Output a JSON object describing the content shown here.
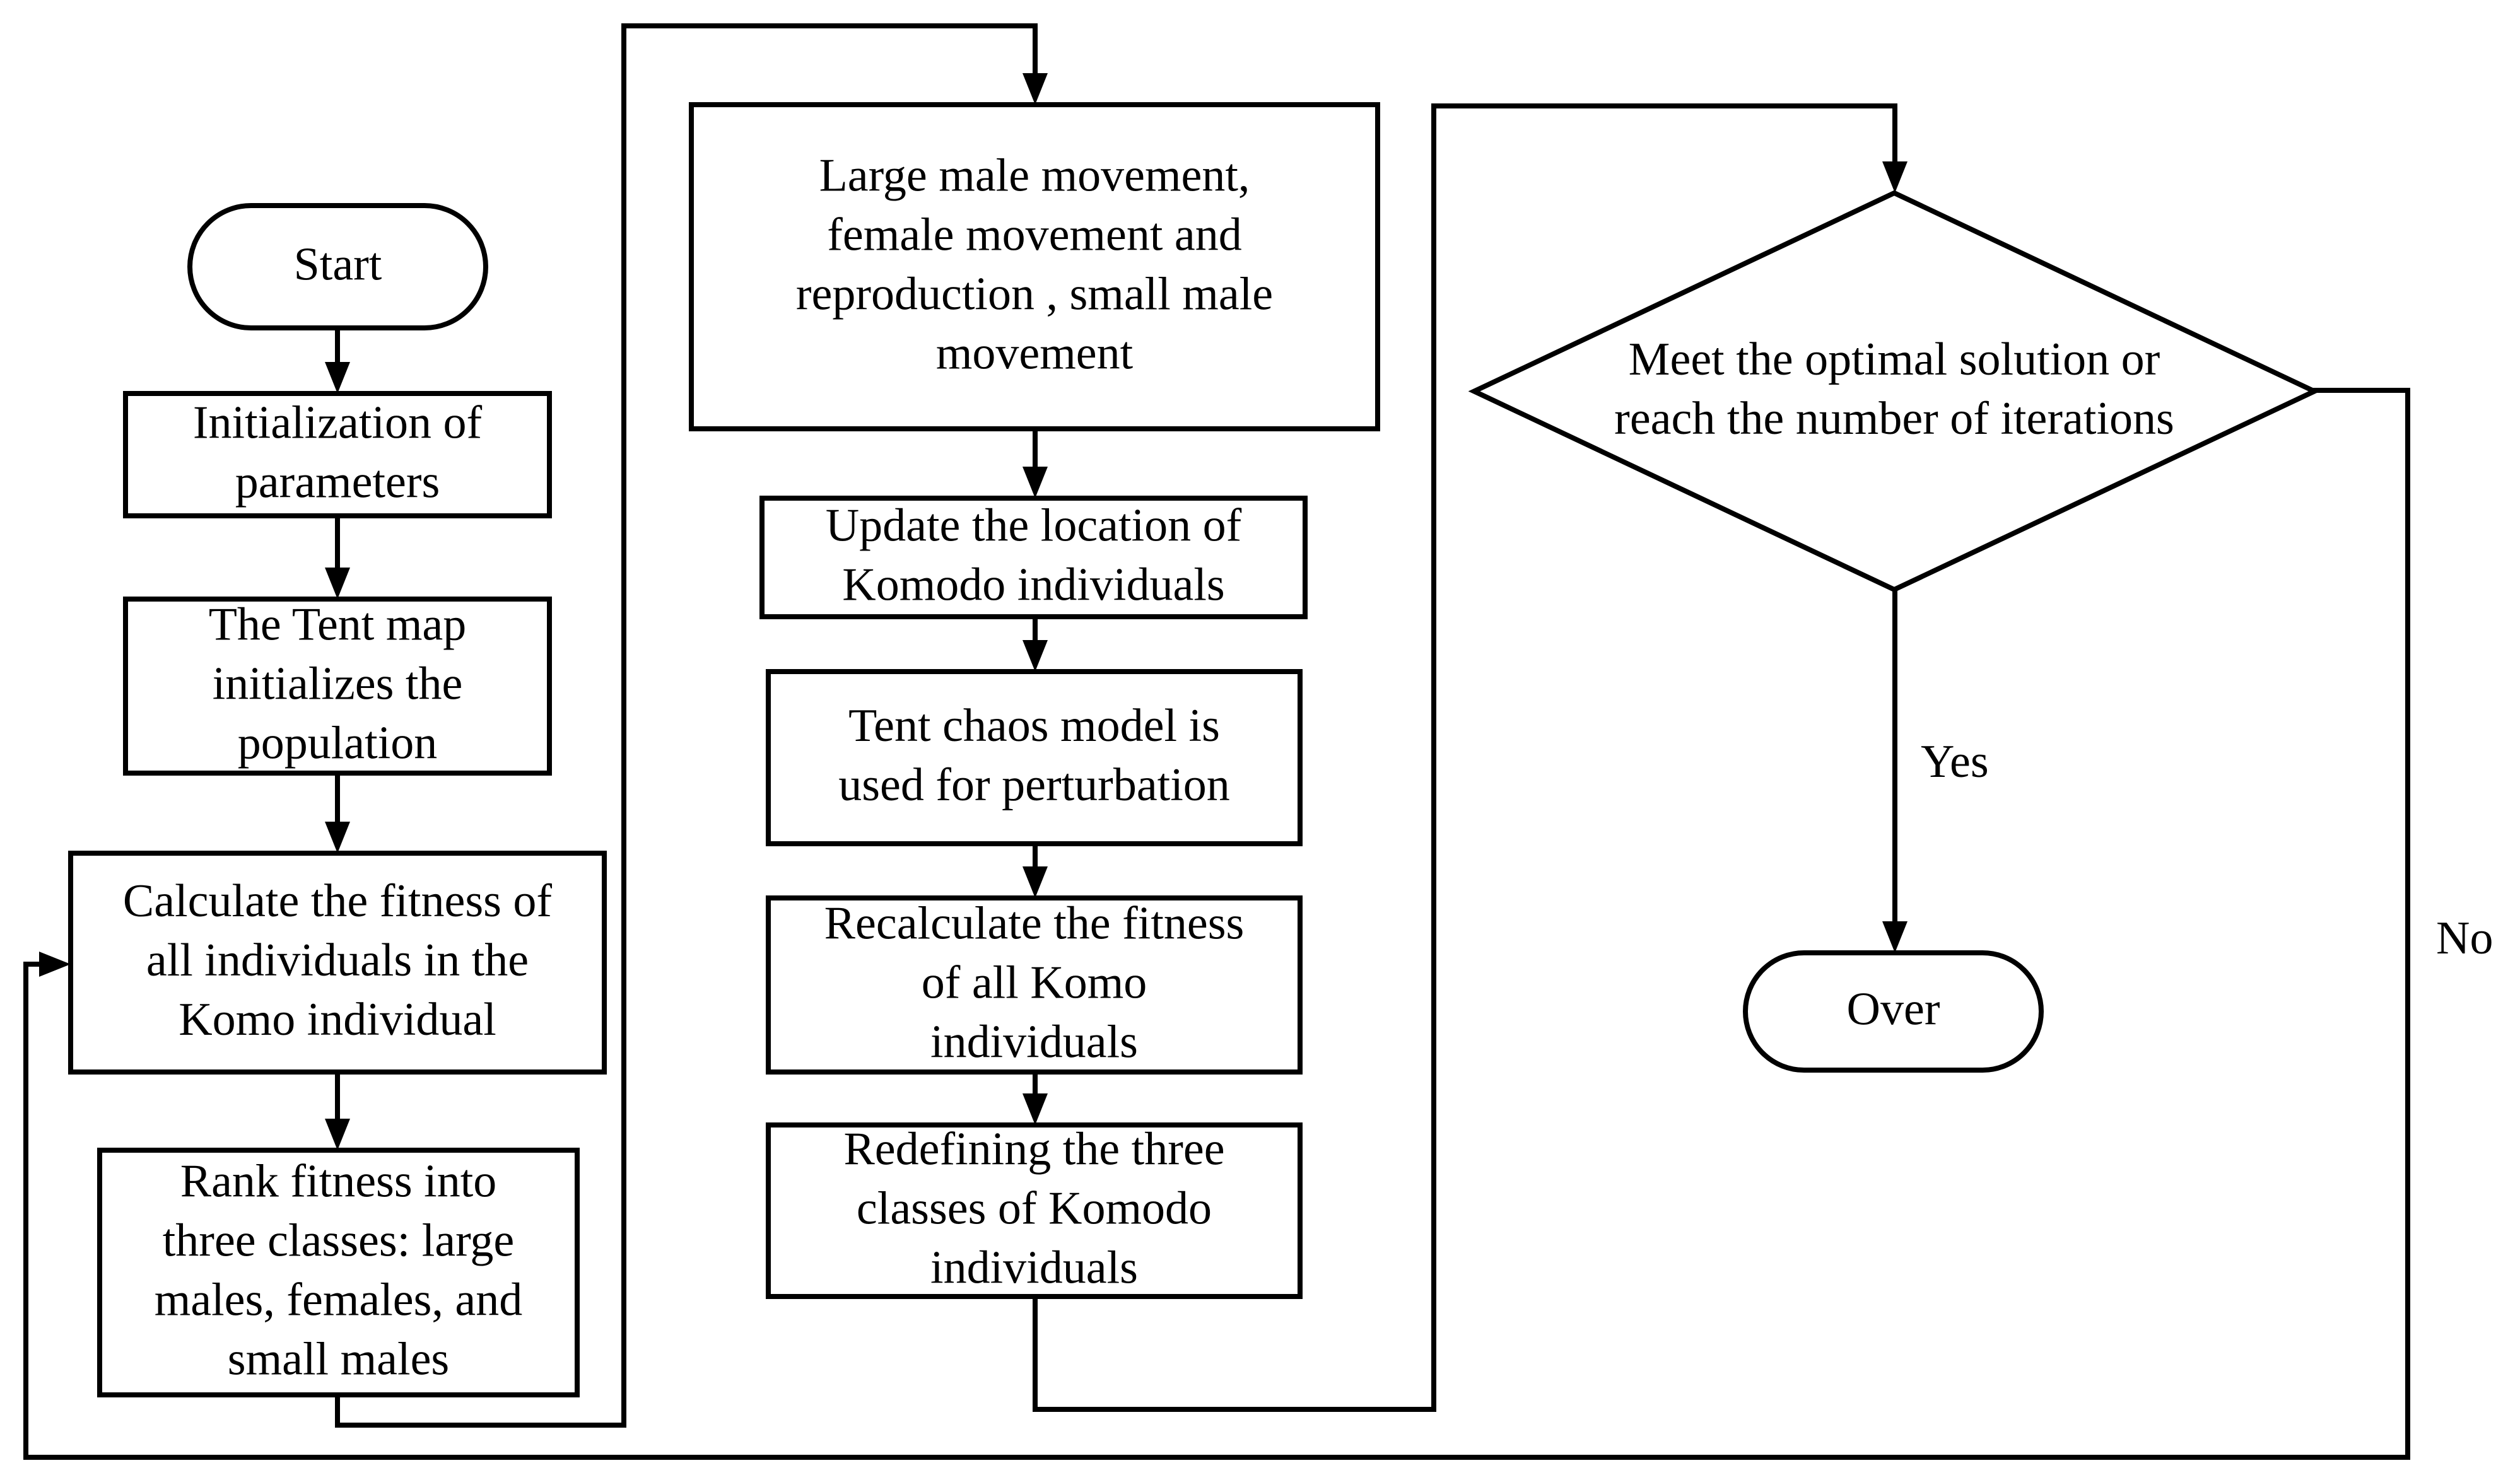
{
  "diagram": {
    "type": "flowchart",
    "nodes": {
      "start": {
        "shape": "terminator",
        "lines": [
          "Start"
        ]
      },
      "init_params": {
        "shape": "process",
        "lines": [
          "Initialization of",
          "parameters"
        ]
      },
      "tent_init": {
        "shape": "process",
        "lines": [
          "The Tent map",
          "initializes the",
          "population"
        ]
      },
      "calc_fitness": {
        "shape": "process",
        "lines": [
          "Calculate the fitness of",
          "all individuals in the",
          "Komo individual"
        ]
      },
      "rank_fitness": {
        "shape": "process",
        "lines": [
          "Rank fitness into",
          "three classes: large",
          "males, females, and",
          "small males"
        ]
      },
      "movement": {
        "shape": "process",
        "lines": [
          "Large male movement,",
          "female movement and",
          "reproduction , small male",
          "movement"
        ]
      },
      "update_location": {
        "shape": "process",
        "lines": [
          "Update the location of",
          "Komodo individuals"
        ]
      },
      "tent_chaos": {
        "shape": "process",
        "lines": [
          "Tent chaos model is",
          "used for perturbation"
        ]
      },
      "recalc_fitness": {
        "shape": "process",
        "lines": [
          "Recalculate the fitness",
          "of all Komo",
          "individuals"
        ]
      },
      "redefine_classes": {
        "shape": "process",
        "lines": [
          "Redefining the three",
          "classes of Komodo",
          "individuals"
        ]
      },
      "decision": {
        "shape": "decision",
        "lines": [
          "Meet the optimal solution or",
          "reach the number of iterations"
        ]
      },
      "over": {
        "shape": "terminator",
        "lines": [
          "Over"
        ]
      }
    },
    "edges": [
      {
        "from": "start",
        "to": "init_params",
        "label": ""
      },
      {
        "from": "init_params",
        "to": "tent_init",
        "label": ""
      },
      {
        "from": "tent_init",
        "to": "calc_fitness",
        "label": ""
      },
      {
        "from": "calc_fitness",
        "to": "rank_fitness",
        "label": ""
      },
      {
        "from": "rank_fitness",
        "to": "movement",
        "label": ""
      },
      {
        "from": "movement",
        "to": "update_location",
        "label": ""
      },
      {
        "from": "update_location",
        "to": "tent_chaos",
        "label": ""
      },
      {
        "from": "tent_chaos",
        "to": "recalc_fitness",
        "label": ""
      },
      {
        "from": "recalc_fitness",
        "to": "redefine_classes",
        "label": ""
      },
      {
        "from": "redefine_classes",
        "to": "decision",
        "label": ""
      },
      {
        "from": "decision",
        "to": "over",
        "label": "Yes"
      },
      {
        "from": "decision",
        "to": "calc_fitness",
        "label": "No"
      }
    ],
    "labels": {
      "yes": "Yes",
      "no": "No"
    },
    "colors": {
      "stroke": "#000000",
      "fill": "#ffffff",
      "text": "#000000"
    }
  }
}
